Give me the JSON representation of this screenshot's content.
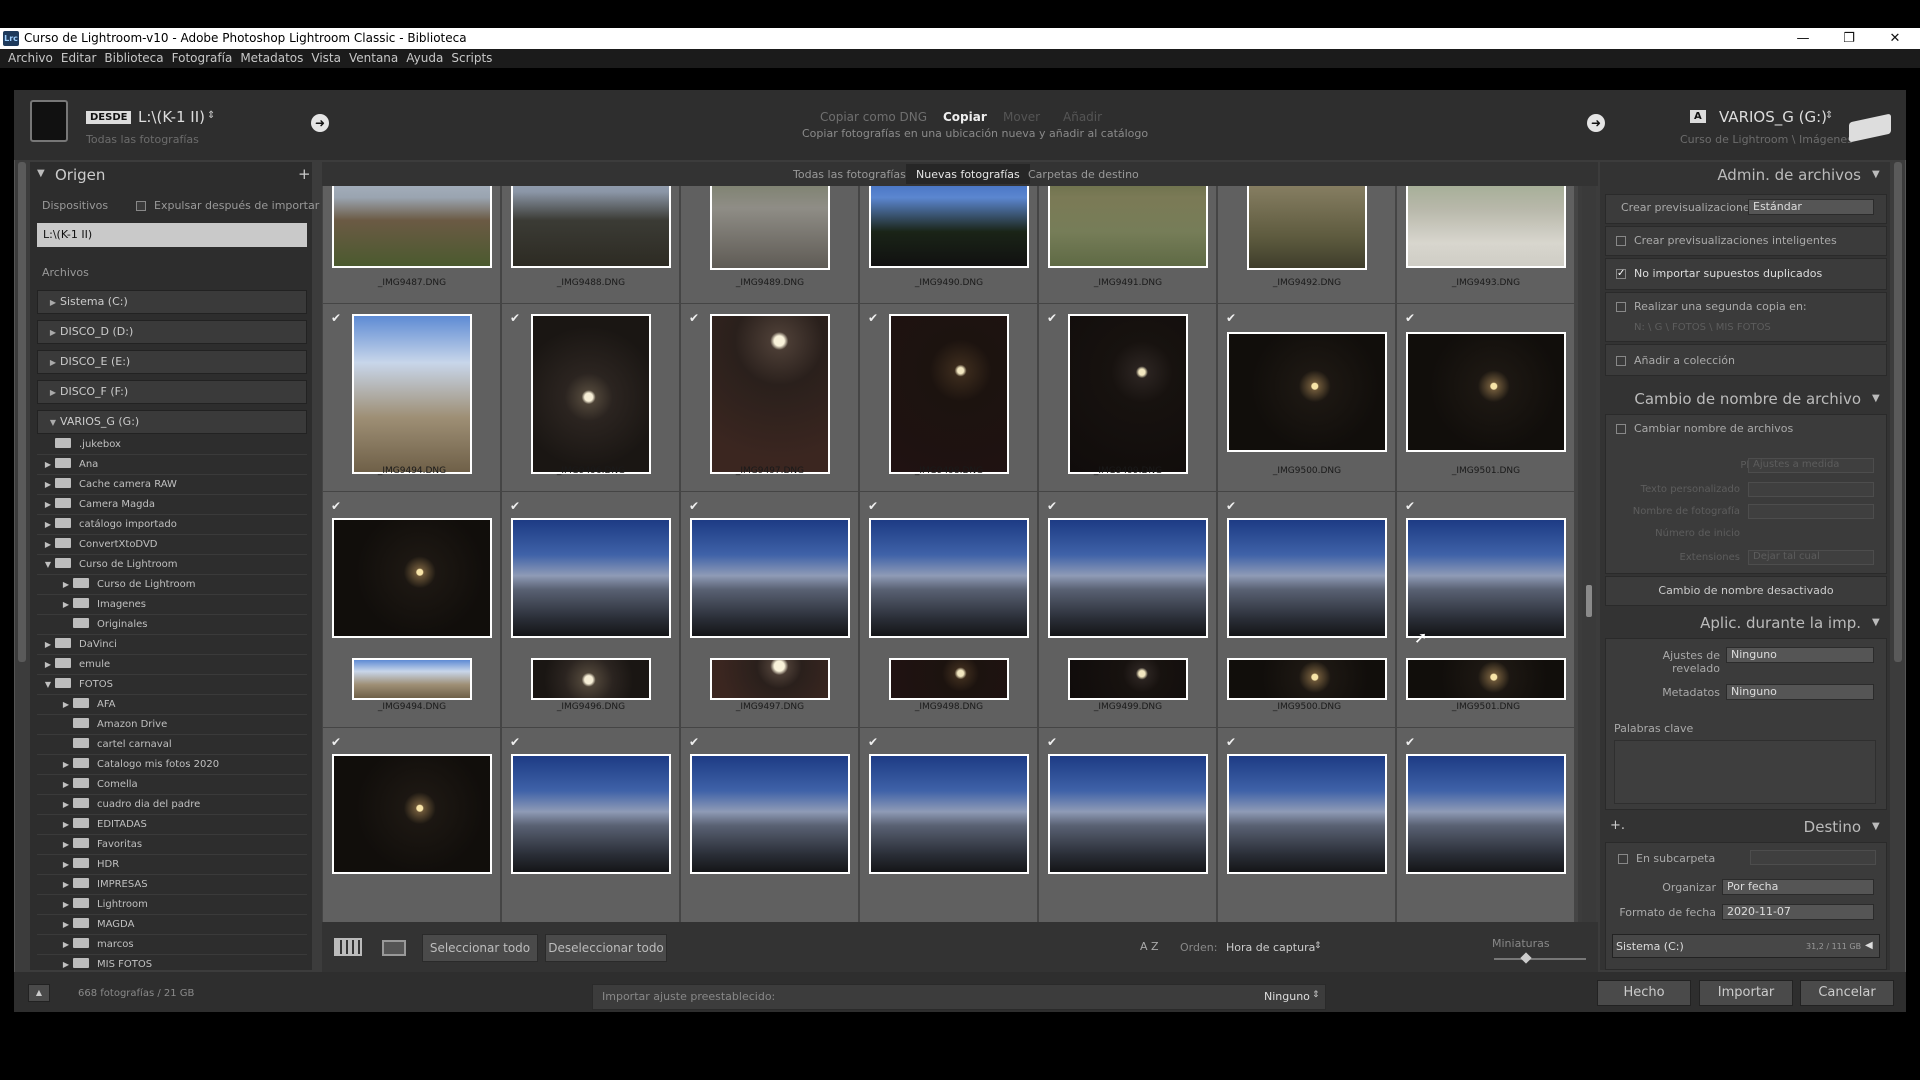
{
  "window": {
    "app_icon": "Lrc",
    "title": "Curso de Lightroom-v10 - Adobe Photoshop Lightroom Classic - Biblioteca",
    "min": "—",
    "max": "❐",
    "close": "✕"
  },
  "menu": [
    "Archivo",
    "Editar",
    "Biblioteca",
    "Fotografía",
    "Metadatos",
    "Vista",
    "Ventana",
    "Ayuda",
    "Scripts"
  ],
  "header": {
    "from_badge": "DESDE",
    "source": "L:\\(K-1 II)",
    "source_sub": "Todas las fotografías",
    "modes": [
      "Copiar como DNG",
      "Copiar",
      "Mover",
      "Añadir"
    ],
    "mode_desc": "Copiar fotografías en una ubicación nueva y añadir al catálogo",
    "dest_badge": "A",
    "destination": "VARIOS_G (G:)",
    "dest_sub": "Curso de Lightroom \\ Imágenes"
  },
  "left": {
    "title": "Origen",
    "devices": "Dispositivos",
    "eject": "Expulsar después de importar",
    "device_item": "L:\\(K-1 II)",
    "files": "Archivos",
    "volumes": [
      "Sistema (C:)",
      "DISCO_D (D:)",
      "DISCO_E (E:)",
      "DISCO_F (F:)",
      "VARIOS_G (G:)"
    ],
    "folders": [
      {
        "name": ".jukebox",
        "tri": "",
        "indent": 0
      },
      {
        "name": "Ana",
        "tri": "▶",
        "indent": 0
      },
      {
        "name": "Cache camera RAW",
        "tri": "▶",
        "indent": 0
      },
      {
        "name": "Camera Magda",
        "tri": "▶",
        "indent": 0
      },
      {
        "name": "catálogo importado",
        "tri": "▶",
        "indent": 0
      },
      {
        "name": "ConvertXtoDVD",
        "tri": "▶",
        "indent": 0
      },
      {
        "name": "Curso de Lightroom",
        "tri": "▼",
        "indent": 0
      },
      {
        "name": "Curso de Lightroom",
        "tri": "▶",
        "indent": 1
      },
      {
        "name": "Imagenes",
        "tri": "▶",
        "indent": 1
      },
      {
        "name": "Originales",
        "tri": "",
        "indent": 1
      },
      {
        "name": "DaVinci",
        "tri": "▶",
        "indent": 0
      },
      {
        "name": "emule",
        "tri": "▶",
        "indent": 0
      },
      {
        "name": "FOTOS",
        "tri": "▼",
        "indent": 0
      },
      {
        "name": "AFA",
        "tri": "▶",
        "indent": 1
      },
      {
        "name": "Amazon Drive",
        "tri": "",
        "indent": 1
      },
      {
        "name": "cartel carnaval",
        "tri": "",
        "indent": 1
      },
      {
        "name": "Catalogo mis fotos 2020",
        "tri": "▶",
        "indent": 1
      },
      {
        "name": "Comella",
        "tri": "▶",
        "indent": 1
      },
      {
        "name": "cuadro dia del padre",
        "tri": "▶",
        "indent": 1
      },
      {
        "name": "EDITADAS",
        "tri": "▶",
        "indent": 1
      },
      {
        "name": "Favoritas",
        "tri": "▶",
        "indent": 1
      },
      {
        "name": "HDR",
        "tri": "▶",
        "indent": 1
      },
      {
        "name": "IMPRESAS",
        "tri": "▶",
        "indent": 1
      },
      {
        "name": "Lightroom",
        "tri": "▶",
        "indent": 1
      },
      {
        "name": "MAGDA",
        "tri": "▶",
        "indent": 1
      },
      {
        "name": "marcos",
        "tri": "▶",
        "indent": 1
      },
      {
        "name": "MIS FOTOS",
        "tri": "▶",
        "indent": 1
      }
    ]
  },
  "tabs": [
    "Todas las fotografías",
    "Nuevas fotografías",
    "Carpetas de destino"
  ],
  "grid": {
    "row1": [
      "_IMG9487.DNG",
      "_IMG9488.DNG",
      "_IMG9489.DNG",
      "_IMG9490.DNG",
      "_IMG9491.DNG",
      "_IMG9492.DNG",
      "_IMG9493.DNG"
    ],
    "row2": [
      "_IMG9494.DNG",
      "_IMG9496.DNG",
      "_IMG9497.DNG",
      "_IMG9498.DNG",
      "_IMG9499.DNG",
      "_IMG9500.DNG",
      "_IMG9501.DNG"
    ],
    "row3": [
      "_IMG9494.DNG",
      "_IMG9496.DNG",
      "_IMG9497.DNG",
      "_IMG9498.DNG",
      "_IMG9499.DNG",
      "_IMG9500.DNG",
      "_IMG9501.DNG"
    ]
  },
  "toolbar": {
    "select_all": "Seleccionar todo",
    "deselect_all": "Deseleccionar todo",
    "az": "A Z",
    "order_label": "Orden:",
    "order_value": "Hora de captura",
    "thumbs": "Miniaturas"
  },
  "right": {
    "file_mgmt": "Admin. de archivos",
    "previews_label": "Crear previsualizaciones",
    "previews_value": "Estándar",
    "smart_previews": "Crear previsualizaciones inteligentes",
    "no_dupes": "No importar supuestos duplicados",
    "second_copy": "Realizar una segunda copia en:",
    "second_copy_path": "N: \\ G \\ FOTOS \\ MIS FOTOS",
    "add_collection": "Añadir a colección",
    "rename_title": "Cambio de nombre de archivo",
    "rename_cb": "Cambiar nombre de archivos",
    "template_label": "Plantilla",
    "template_value": "Ajustes a medida",
    "custom_text": "Texto personalizado",
    "shoot_name": "Nombre de fotografía",
    "start_number": "Número de inicio",
    "extensions_label": "Extensiones",
    "extensions_value": "Dejar tal cual",
    "rename_disabled": "Cambio de nombre desactivado",
    "apply_title": "Aplic. durante la imp.",
    "develop_label": "Ajustes de revelado",
    "develop_value": "Ninguno",
    "metadata_label": "Metadatos",
    "metadata_value": "Ninguno",
    "keywords": "Palabras clave",
    "dest_title": "Destino",
    "subfolder": "En subcarpeta",
    "organize_label": "Organizar",
    "organize_value": "Por fecha",
    "date_format_label": "Formato de fecha",
    "date_format_value": "2020-11-07",
    "drive": "Sistema (C:)",
    "drive_size": "31,2 / 111 GB"
  },
  "bottom": {
    "count": "668 fotografías / 21 GB",
    "preset_label": "Importar ajuste preestablecido:",
    "preset_value": "Ninguno",
    "done": "Hecho",
    "import": "Importar",
    "cancel": "Cancelar"
  }
}
